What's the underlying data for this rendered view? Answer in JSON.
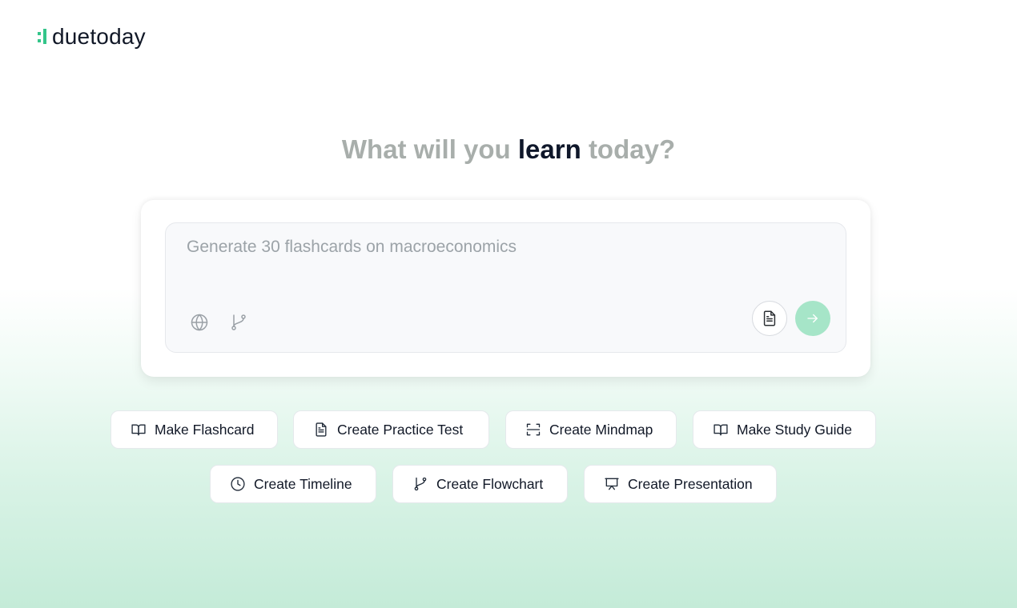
{
  "brand": {
    "name": "duetoday",
    "accent_color": "#34c58a"
  },
  "headline": {
    "part1": "What will you",
    "emphasis": "learn",
    "part2": "today?"
  },
  "prompt": {
    "placeholder": "Generate 30 flashcards on macroeconomics",
    "tools": [
      {
        "icon": "globe-icon"
      },
      {
        "icon": "git-branch-icon"
      }
    ],
    "attach_icon": "document-icon",
    "send_icon": "arrow-right-icon",
    "send_color": "#a6e5c8"
  },
  "suggestions": [
    {
      "label": "Make Flashcard",
      "icon": "book-open-icon"
    },
    {
      "label": "Create Practice Test",
      "icon": "document-icon"
    },
    {
      "label": "Create Mindmap",
      "icon": "scan-icon"
    },
    {
      "label": "Make Study Guide",
      "icon": "book-open-icon"
    },
    {
      "label": "Create Timeline",
      "icon": "clock-icon"
    },
    {
      "label": "Create Flowchart",
      "icon": "git-branch-icon"
    },
    {
      "label": "Create Presentation",
      "icon": "presentation-icon"
    }
  ]
}
